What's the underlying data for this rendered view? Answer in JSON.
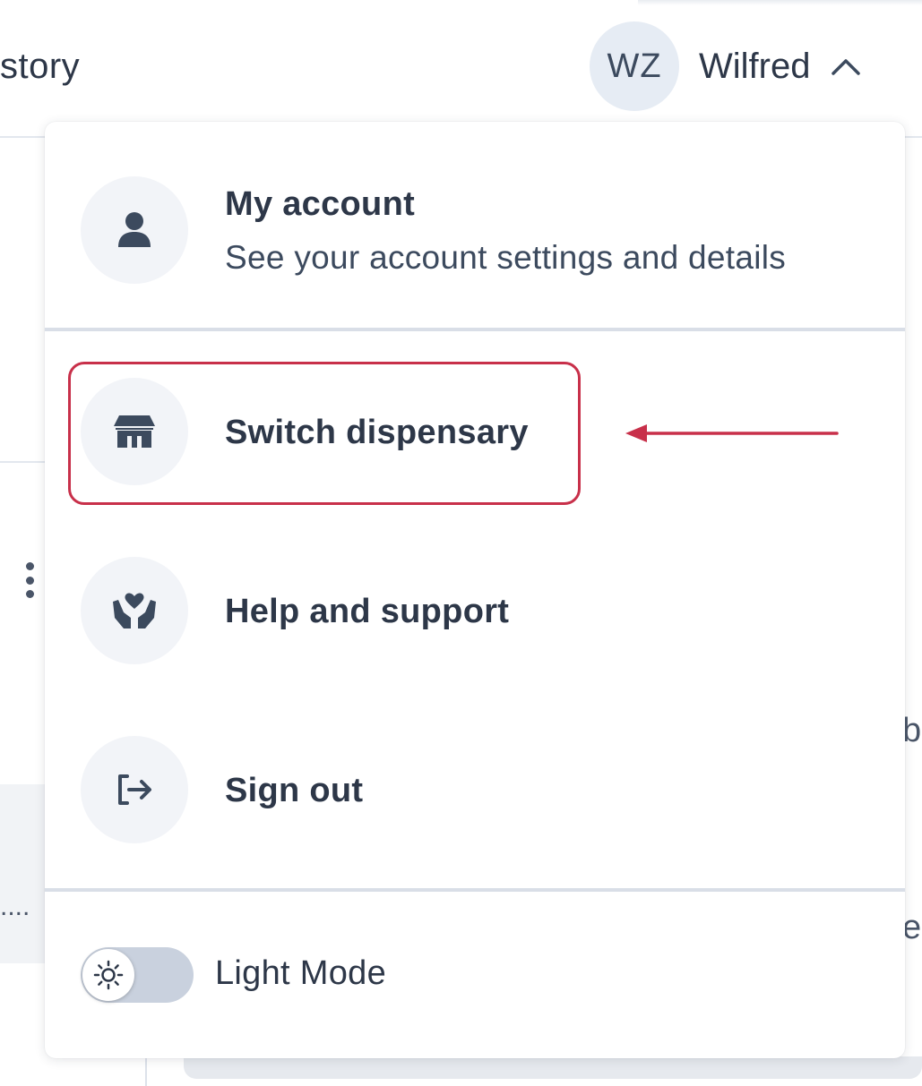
{
  "background": {
    "nav_fragment": "story",
    "list_ellipsis": "....",
    "right_fragment_1": "bl",
    "right_fragment_2": "er"
  },
  "header": {
    "user": {
      "initials": "WZ",
      "name": "Wilfred"
    }
  },
  "menu": {
    "account": {
      "title": "My account",
      "subtitle": "See your account settings and details",
      "icon": "user-icon"
    },
    "items": [
      {
        "label": "Switch dispensary",
        "icon": "store-icon",
        "highlighted": true
      },
      {
        "label": "Help and support",
        "icon": "hands-heart-icon",
        "highlighted": false
      },
      {
        "label": "Sign out",
        "icon": "sign-out-icon",
        "highlighted": false
      }
    ],
    "theme_toggle": {
      "label": "Light Mode",
      "icon": "sun-icon",
      "on": false
    }
  },
  "colors": {
    "highlight": "#c8304a",
    "text": "#2d3748",
    "icon": "#3c4a5e",
    "icon_bg": "#f2f4f8",
    "toggle_track": "#c9d1de"
  }
}
